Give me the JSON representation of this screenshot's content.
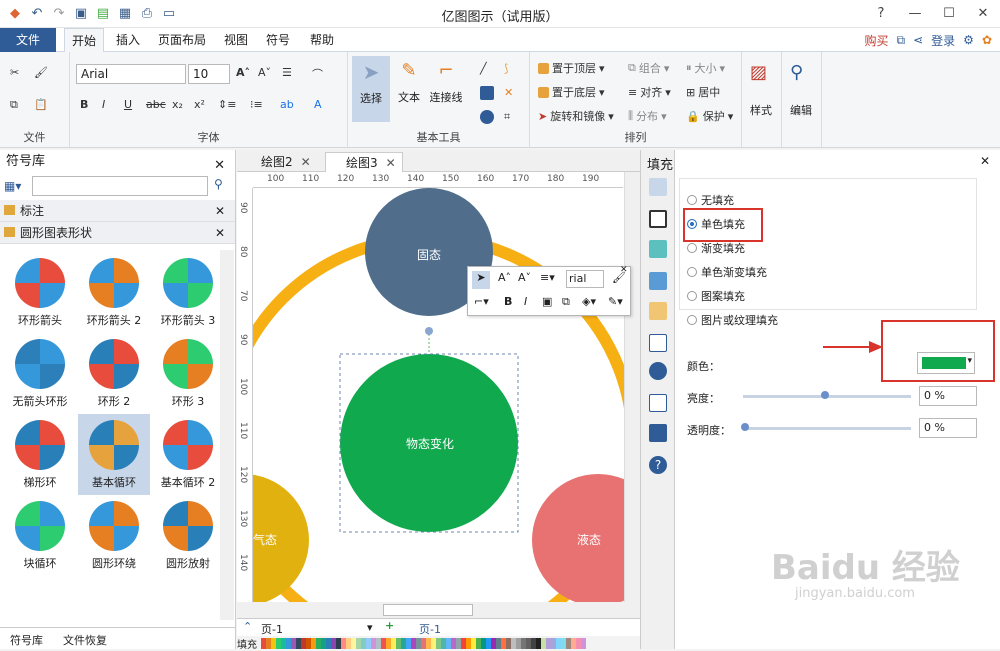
{
  "app": {
    "title": "亿图图示（试用版）"
  },
  "menu": {
    "file": "文件",
    "start": "开始",
    "insert": "插入",
    "layout": "页面布局",
    "view": "视图",
    "symbol": "符号",
    "help": "帮助",
    "buy": "购买",
    "login": "登录"
  },
  "ribbon": {
    "font_name": "Arial",
    "font_size": "10",
    "groups": {
      "file": "文件",
      "font": "字体",
      "basic": "基本工具",
      "arrange": "排列"
    },
    "tools": {
      "select": "选择",
      "text": "文本",
      "connector": "连接线",
      "style": "样式",
      "edit": "编辑"
    },
    "arrange": {
      "top": "置于顶层",
      "bottom": "置于底层",
      "rotate": "旋转和镜像",
      "group": "组合",
      "align": "对齐",
      "distribute": "分布",
      "size": "大小",
      "center": "居中",
      "protect": "保护"
    }
  },
  "left": {
    "title": "符号库",
    "lib1": "标注",
    "lib2": "圆形图表形状",
    "shapes": [
      "环形箭头",
      "环形箭头 2",
      "环形箭头 3",
      "无箭头环形",
      "环形 2",
      "环形 3",
      "梯形环",
      "基本循环",
      "基本循环 2",
      "块循环",
      "圆形环绕",
      "圆形放射"
    ],
    "tabs": {
      "library": "符号库",
      "recover": "文件恢复"
    }
  },
  "doc": {
    "tab1": "绘图2",
    "tab2": "绘图3",
    "page1": "页-1",
    "page1b": "页-1",
    "fill_label": "填充"
  },
  "ruler": {
    "h": [
      "100",
      "110",
      "120",
      "130",
      "140",
      "150",
      "160",
      "170",
      "180",
      "190"
    ],
    "v": [
      "90",
      "80",
      "70",
      "90",
      "100",
      "110",
      "120",
      "130",
      "140"
    ]
  },
  "canvas": {
    "top": "固态",
    "center": "物态变化",
    "left": "气态",
    "right": "液态"
  },
  "mini": {
    "font": "rial"
  },
  "fill": {
    "title": "填充",
    "options": [
      "无填充",
      "单色填充",
      "渐变填充",
      "单色渐变填充",
      "图案填充",
      "图片或纹理填充"
    ],
    "color_label": "颜色：",
    "brightness_label": "亮度：",
    "transparency_label": "透明度：",
    "brightness": "0 %",
    "transparency": "0 %",
    "color_value": "#10a94e"
  },
  "colors": {
    "accent": "#2f5b96",
    "ring": "#f7b014",
    "top": "#506d8c",
    "center": "#10a94e",
    "left": "#e1b20f",
    "right": "#e87272",
    "highlight": "#d9342b"
  },
  "watermark": {
    "line1": "Baidu 经验",
    "line2": "jingyan.baidu.com"
  }
}
